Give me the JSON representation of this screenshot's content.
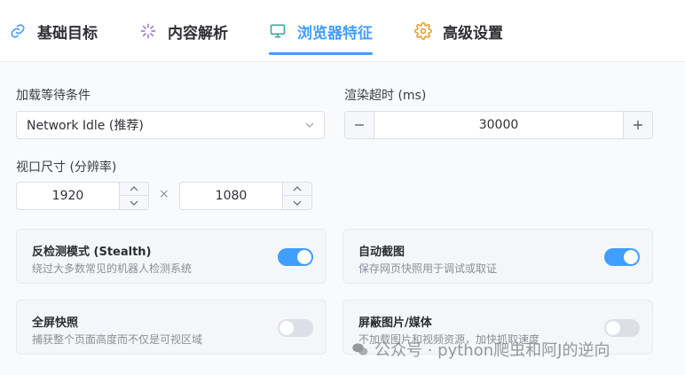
{
  "tabs": [
    {
      "label": "基础目标",
      "icon": "link-icon",
      "active": false
    },
    {
      "label": "内容解析",
      "icon": "sparkle-icon",
      "active": false
    },
    {
      "label": "浏览器特征",
      "icon": "monitor-icon",
      "active": true
    },
    {
      "label": "高级设置",
      "icon": "gear-icon",
      "active": false
    }
  ],
  "colors": {
    "accent": "#409eff",
    "link_icon": "#409eff",
    "sparkle_icon": "#a37bd6",
    "monitor_icon": "#3aaa9c",
    "gear_icon": "#e6a23c"
  },
  "form": {
    "wait_label": "加载等待条件",
    "wait_value": "Network Idle (推荐)",
    "timeout_label": "渲染超时 (ms)",
    "timeout_value": "30000",
    "viewport_label": "视口尺寸 (分辨率)",
    "viewport_width": "1920",
    "viewport_height": "1080",
    "times_sign": "×"
  },
  "options": [
    {
      "title": "反检测模式 (Stealth)",
      "desc": "绕过大多数常见的机器人检测系统",
      "enabled": true
    },
    {
      "title": "自动截图",
      "desc": "保存网页快照用于调试或取证",
      "enabled": true
    },
    {
      "title": "全屏快照",
      "desc": "捕获整个页面高度而不仅是可视区域",
      "enabled": false
    },
    {
      "title": "屏蔽图片/媒体",
      "desc": "不加载图片和视频资源，加快抓取速度",
      "enabled": false
    }
  ],
  "watermark": "公众号 · python爬虫和阿J的逆向"
}
